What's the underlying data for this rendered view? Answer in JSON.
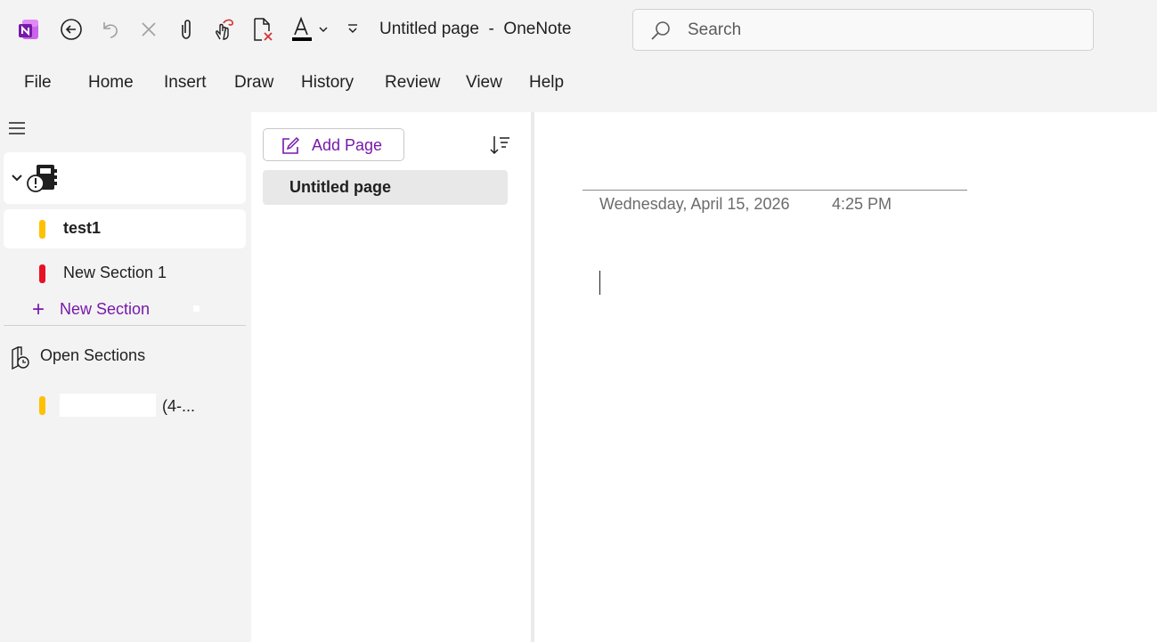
{
  "window": {
    "title": "Untitled page  -  OneNote"
  },
  "quick_access": [
    {
      "name": "onenote-logo-icon"
    },
    {
      "name": "back-icon"
    },
    {
      "name": "undo-icon"
    },
    {
      "name": "delete-icon"
    },
    {
      "name": "attach-file-icon"
    },
    {
      "name": "touch-draw-icon"
    },
    {
      "name": "delete-page-icon"
    },
    {
      "name": "font-color-icon",
      "color": "#000000"
    },
    {
      "name": "customize-toolbar-icon"
    }
  ],
  "search": {
    "placeholder": "Search"
  },
  "menu": {
    "items": [
      "File",
      "Home",
      "Insert",
      "Draw",
      "History",
      "Review",
      "View",
      "Help"
    ]
  },
  "nav": {
    "notebook_icon": "notebook-sync-error-icon",
    "sections": [
      {
        "label": "test1",
        "color": "#ffc000",
        "selected": true
      },
      {
        "label": "New Section 1",
        "color": "#e81123",
        "selected": false
      }
    ],
    "new_section_label": "New Section",
    "open_sections_label": "Open Sections",
    "open_section_tail": "(4-...",
    "open_section_color": "#ffc000"
  },
  "pages": {
    "add_page_label": "Add Page",
    "items": [
      "Untitled page"
    ]
  },
  "canvas": {
    "date": "Wednesday, April 15, 2026",
    "time": "4:25 PM"
  },
  "colors": {
    "accent": "#7719aa",
    "background": "#f3f3f3"
  }
}
